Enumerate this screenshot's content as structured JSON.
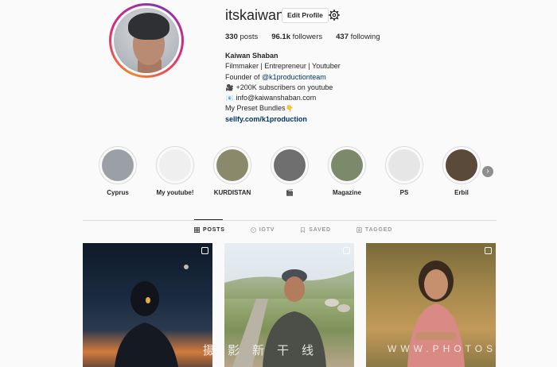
{
  "profile": {
    "username": "itskaiwan",
    "edit_label": "Edit Profile",
    "posts_count": "330",
    "posts_label": "posts",
    "followers_count": "96.1k",
    "followers_label": "followers",
    "following_count": "437",
    "following_label": "following"
  },
  "bio": {
    "name": "Kaiwan Shaban",
    "line1": "Filmmaker | Entrepreneur | Youtuber",
    "founder_prefix": "Founder of ",
    "founder_tag": "@k1productionteam",
    "youtube": "+200K subscribers on youtube",
    "email": "info@kaiwanshaban.com",
    "presets": "My Preset Bundles",
    "link": "sellfy.com/k1production"
  },
  "highlights": [
    {
      "label": "Cyprus",
      "color": "#9aa0a6"
    },
    {
      "label": "My youtube!",
      "color": "#efefef"
    },
    {
      "label": "KURDISTAN",
      "color": "#8a8a6a"
    },
    {
      "label": "🎬",
      "color": "#6f6f6f"
    },
    {
      "label": "Magazine",
      "color": "#7b8a6a"
    },
    {
      "label": "PS",
      "color": "#e6e6e6"
    },
    {
      "label": "Erbil",
      "color": "#5a4a3a"
    }
  ],
  "tabs": {
    "posts": "POSTS",
    "igtv": "IGTV",
    "saved": "SAVED",
    "tagged": "TAGGED"
  },
  "colors": {
    "accent": "#003569",
    "border": "#dbdbdb"
  }
}
